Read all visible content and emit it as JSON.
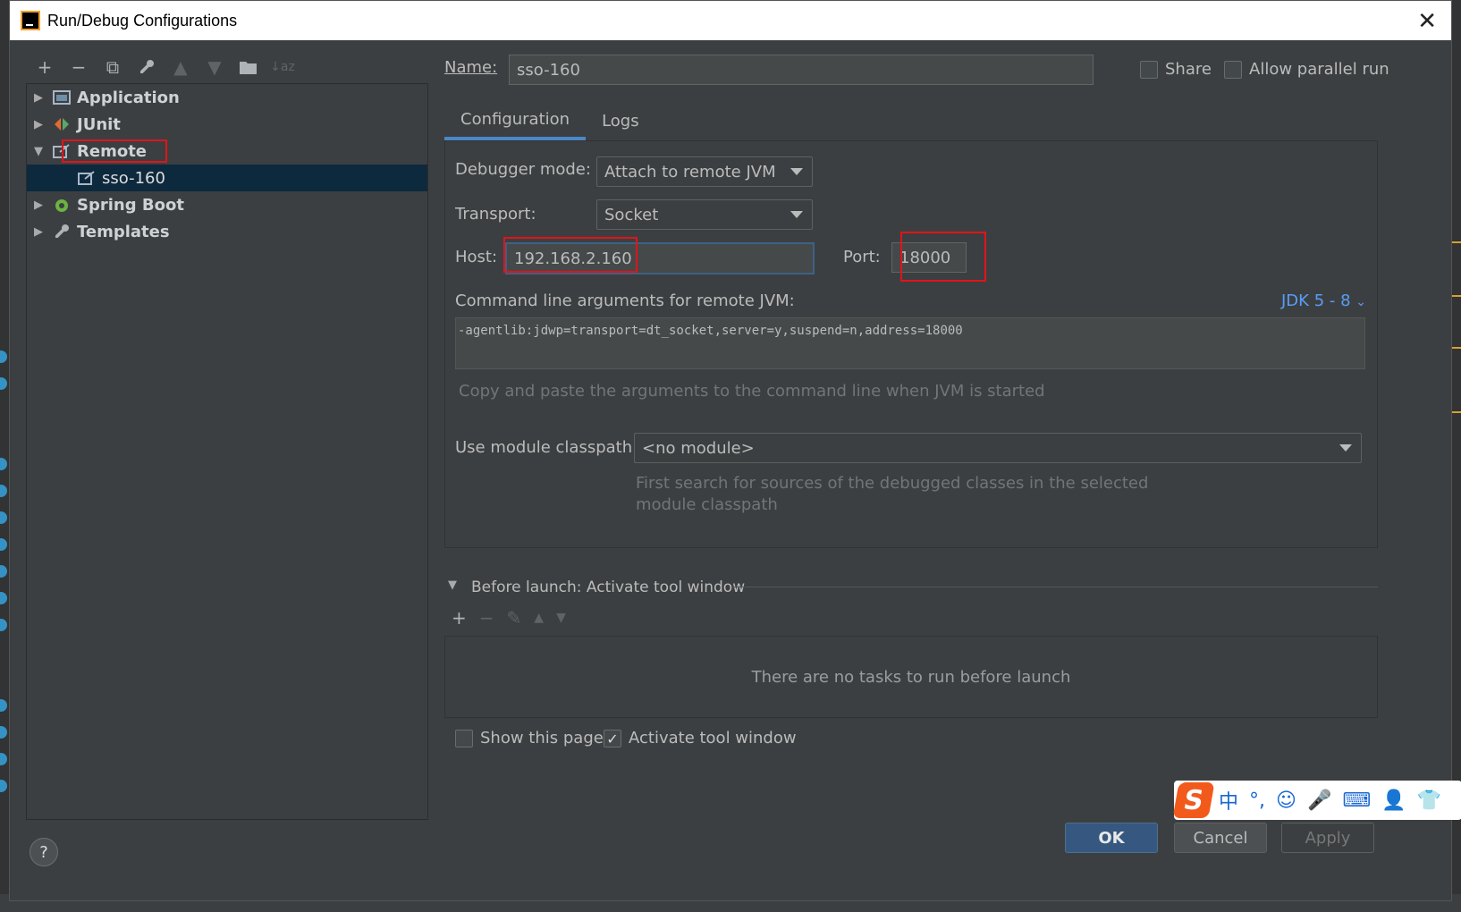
{
  "window": {
    "title": "Run/Debug Configurations",
    "close_glyph": "✕"
  },
  "toolbar": {
    "icons": [
      "+",
      "−",
      "⧉",
      "🔧",
      "▲",
      "▼",
      "📁",
      "↓az"
    ]
  },
  "tree": {
    "items": [
      {
        "label": "Application",
        "expanded": false
      },
      {
        "label": "JUnit",
        "expanded": false
      },
      {
        "label": "Remote",
        "expanded": true
      },
      {
        "label": "sso-160",
        "child": true,
        "selected": true
      },
      {
        "label": "Spring Boot",
        "expanded": false
      },
      {
        "label": "Templates",
        "expanded": false
      }
    ]
  },
  "config": {
    "name_label": "Name:",
    "name_value": "sso-160",
    "share_label": "Share",
    "parallel_label": "Allow parallel run",
    "tabs": [
      "Configuration",
      "Logs"
    ],
    "debugger_mode_label": "Debugger mode:",
    "debugger_mode_value": "Attach to remote JVM",
    "transport_label": "Transport:",
    "transport_value": "Socket",
    "host_label": "Host:",
    "host_value": "192.168.2.160",
    "port_label": "Port:",
    "port_value": "18000",
    "cmd_label": "Command line arguments for remote JVM:",
    "jdk_link": "JDK 5 - 8",
    "cmd_value": "-agentlib:jdwp=transport=dt_socket,server=y,suspend=n,address=18000",
    "cmd_hint": "Copy and paste the arguments to the command line when JVM is started",
    "module_label": "Use module classpath:",
    "module_value": "<no module>",
    "module_hint_1": "First search for sources of the debugged classes in the selected",
    "module_hint_2": "module classpath"
  },
  "before_launch": {
    "title": "Before launch: Activate tool window",
    "empty_text": "There are no tasks to run before launch",
    "show_page_label": "Show this page",
    "activate_label": "Activate tool window",
    "show_page_checked": false,
    "activate_checked": true
  },
  "buttons": {
    "ok": "OK",
    "cancel": "Cancel",
    "apply": "Apply",
    "help": "?"
  },
  "ime": {
    "logo": "S",
    "items": [
      "中",
      "°,",
      "☺",
      "🎤",
      "⌨",
      "👤",
      "👕"
    ]
  },
  "colors": {
    "accent": "#4a88c7",
    "annotation_red": "#e0141a",
    "selection": "#0d293e"
  }
}
